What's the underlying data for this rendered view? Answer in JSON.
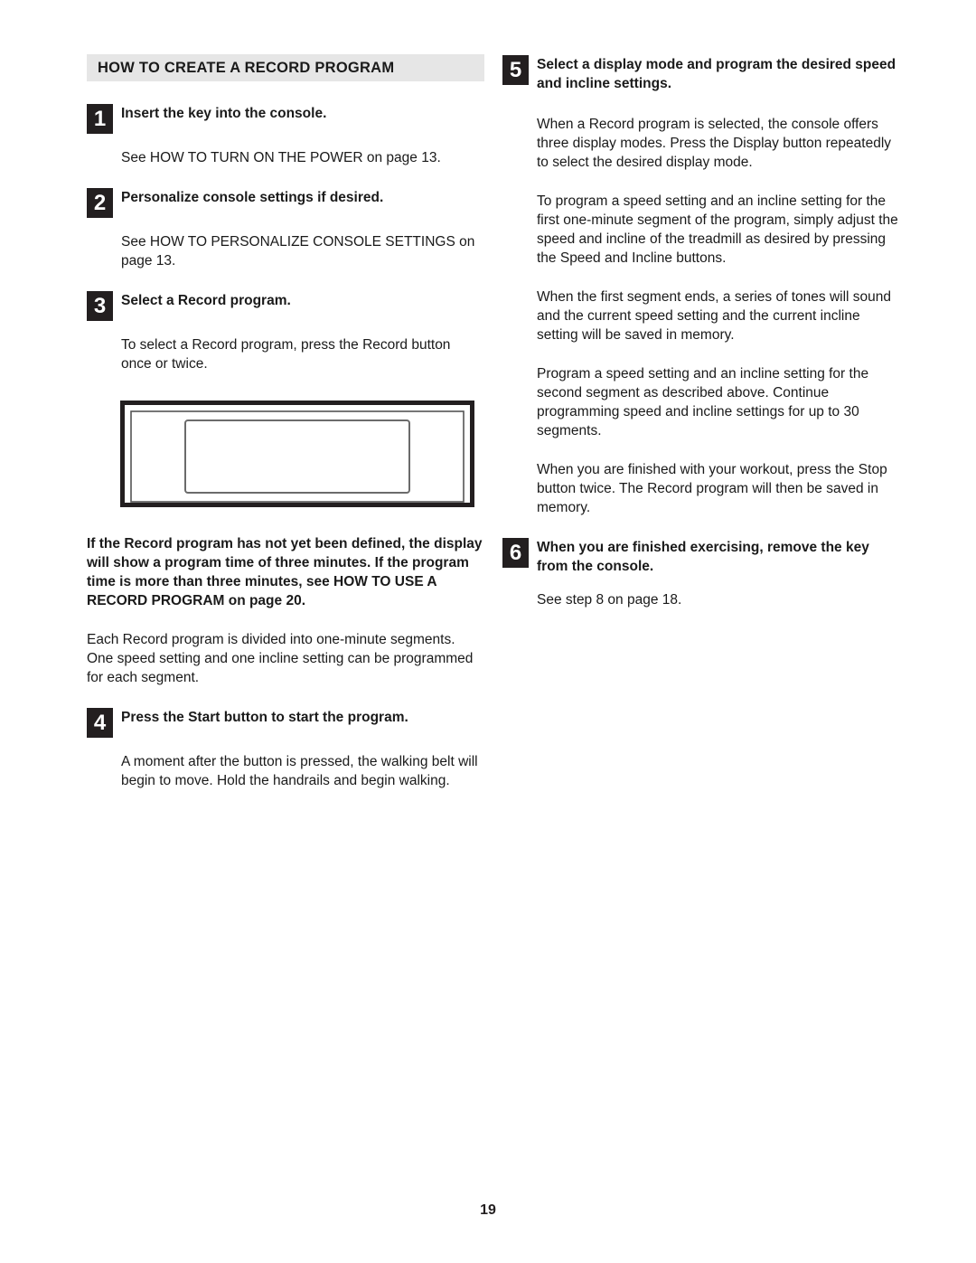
{
  "document": {
    "section_title": "HOW TO CREATE A RECORD PROGRAM",
    "page_number": "19"
  },
  "left_column": {
    "steps": [
      {
        "number": "1",
        "title": "Insert the key into the console.",
        "body": [
          "See HOW TO TURN ON THE POWER on page 13."
        ]
      },
      {
        "number": "2",
        "title": "Personalize console settings if desired.",
        "body": [
          "See HOW TO PERSONALIZE CONSOLE SETTINGS on page 13."
        ]
      },
      {
        "number": "3",
        "title": "Select a Record program.",
        "body": [
          "To select a Record program, press the Record button once or twice."
        ]
      },
      {
        "number": "4",
        "title": "Press the Start button to start the program.",
        "body": [
          "A moment after the button is pressed, the walking belt will begin to move. Hold the handrails and begin walking."
        ]
      }
    ],
    "figure": {
      "name": "console-display-illustration"
    },
    "note_bold": "If the Record program has not yet been defined, the display will show a program time of three minutes. If the program time is more than three minutes, see HOW TO USE A RECORD PROGRAM on page 20.",
    "note_body": "Each Record program is divided into one-minute segments. One speed setting and one incline setting can be programmed for each segment."
  },
  "right_column": {
    "steps": [
      {
        "number": "5",
        "title": "Select a display mode and program the desired speed and incline settings.",
        "body": [
          "When a Record program is selected, the console offers three display modes. Press the Display button repeatedly to select the desired display mode.",
          "To program a speed setting and an incline setting for the first one-minute segment of the program, simply adjust the speed and incline of the treadmill as desired by pressing the Speed and Incline buttons.",
          "When the first segment ends, a series of tones will sound and the current speed setting and the current incline setting will be saved in memory.",
          "Program a speed setting and an incline setting for the second segment as described above. Continue programming speed and incline settings for up to 30 segments.",
          "When you are finished with your workout, press the Stop button twice. The Record program will then be saved in memory."
        ]
      },
      {
        "number": "6",
        "title": "When you are finished exercising, remove the key from the console.",
        "body": [
          "See step 8 on page 18."
        ]
      }
    ]
  }
}
